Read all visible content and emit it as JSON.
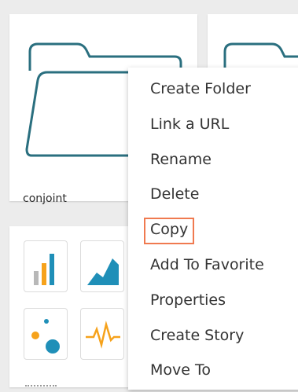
{
  "folder_card": {
    "name": "conjoint"
  },
  "colors": {
    "folder_stroke": "#2a6f7f",
    "bar_gray": "#b8b8b8",
    "bar_orange": "#f6a21b",
    "bar_blue": "#1f8fb8",
    "highlight_border": "#f07a50"
  },
  "context_menu": {
    "items": [
      {
        "label": "Create Folder"
      },
      {
        "label": "Link a URL"
      },
      {
        "label": "Rename"
      },
      {
        "label": "Delete"
      },
      {
        "label": "Copy",
        "highlighted": true
      },
      {
        "label": "Add To Favorite"
      },
      {
        "label": "Properties"
      },
      {
        "label": "Create Story"
      },
      {
        "label": "Move To"
      }
    ]
  },
  "icons": [
    "folder-icon",
    "bar-chart-icon",
    "area-chart-icon",
    "bubble-chart-icon",
    "pulse-chart-icon"
  ]
}
